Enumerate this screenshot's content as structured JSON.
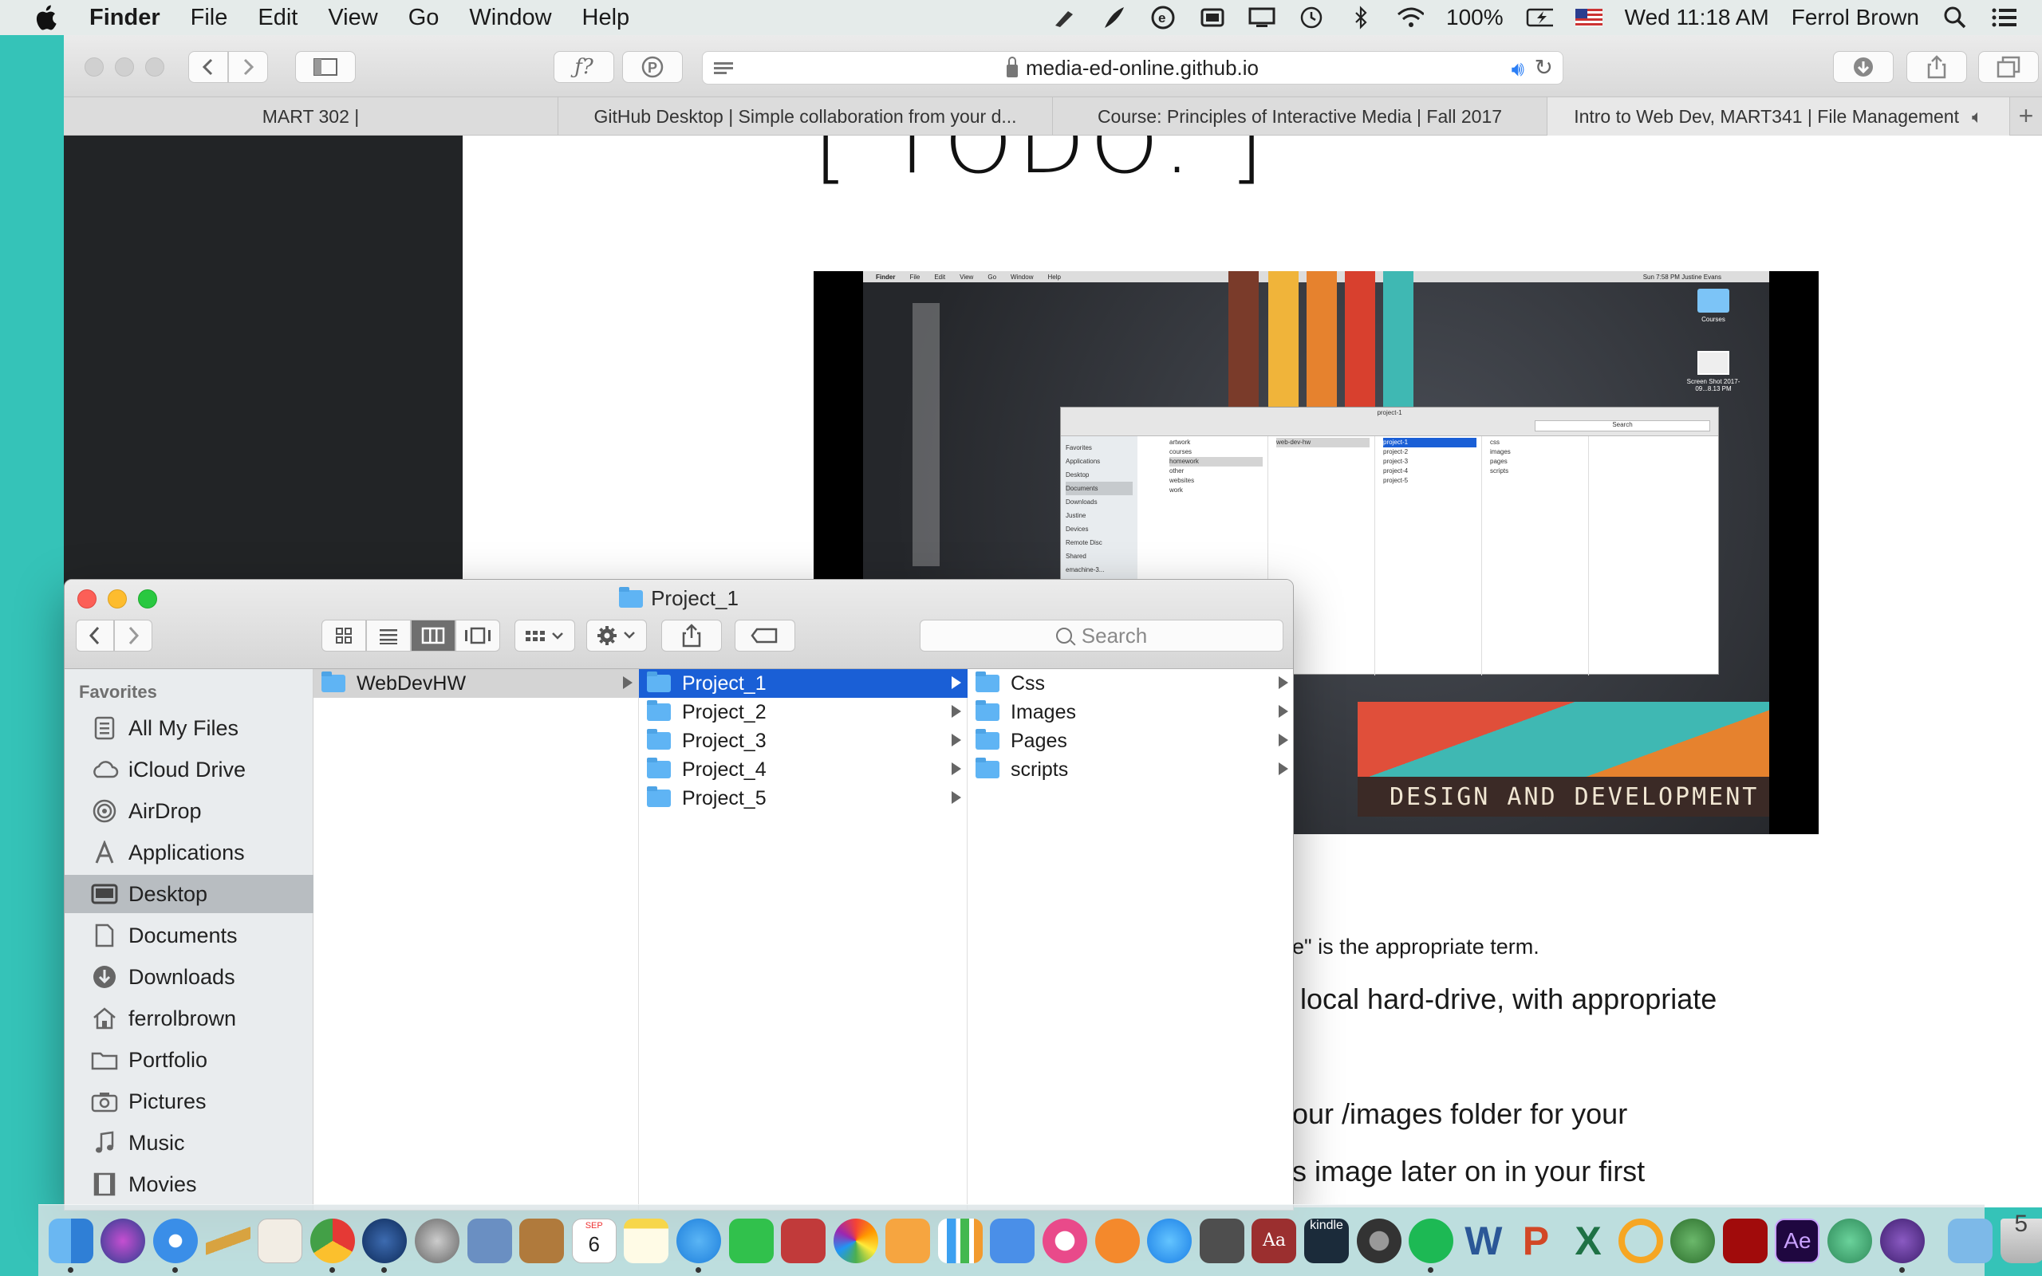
{
  "menubar": {
    "app_name": "Finder",
    "menus": [
      "File",
      "Edit",
      "View",
      "Go",
      "Window",
      "Help"
    ],
    "battery": "100%",
    "clock": "Wed 11:18 AM",
    "user": "Ferrol Brown"
  },
  "browser": {
    "url": "media-ed-online.github.io",
    "tabs": [
      {
        "label": "MART 302 |"
      },
      {
        "label": "GitHub Desktop | Simple collaboration from your d..."
      },
      {
        "label": "Course: Principles of Interactive Media | Fall 2017"
      },
      {
        "label": "Intro to Web Dev, MART341 | File Management"
      }
    ],
    "page": {
      "heading": "[ TODO: ]",
      "lines": [
        "e\" is the appropriate term.",
        "local hard-drive, with appropriate",
        "our /images folder for your",
        "s image later on in your first"
      ],
      "embedded": {
        "banner": "DESIGN AND DEVELOPMENT",
        "mini_menus": [
          "Finder",
          "File",
          "Edit",
          "View",
          "Go",
          "Window",
          "Help"
        ],
        "mini_status": "Sun 7:58 PM   Justine Evans",
        "mini_title": "project-1",
        "mini_search": "Search",
        "mini_sidebar": [
          "Favorites",
          "Applications",
          "Desktop",
          "Documents",
          "Downloads",
          "Justine",
          "Devices",
          "Remote Disc",
          "Shared",
          "emachine-3..."
        ],
        "mini_col1": [
          "artwork",
          "courses",
          "homework",
          "other",
          "websites",
          "work"
        ],
        "mini_col2": [
          "web-dev-hw"
        ],
        "mini_col3": [
          "project-1",
          "project-2",
          "project-3",
          "project-4",
          "project-5"
        ],
        "mini_col4": [
          "css",
          "images",
          "pages",
          "scripts"
        ],
        "desk_icon1": "Courses",
        "desk_icon2": "Screen Shot 2017-09...8.13 PM"
      }
    }
  },
  "finder": {
    "title": "Project_1",
    "search_placeholder": "Search",
    "sidebar_heading": "Favorites",
    "sidebar": [
      {
        "label": "All My Files",
        "icon": "all-files-icon"
      },
      {
        "label": "iCloud Drive",
        "icon": "cloud-icon"
      },
      {
        "label": "AirDrop",
        "icon": "airdrop-icon"
      },
      {
        "label": "Applications",
        "icon": "applications-icon"
      },
      {
        "label": "Desktop",
        "icon": "desktop-icon",
        "selected": true
      },
      {
        "label": "Documents",
        "icon": "documents-icon"
      },
      {
        "label": "Downloads",
        "icon": "downloads-icon"
      },
      {
        "label": "ferrolbrown",
        "icon": "home-icon"
      },
      {
        "label": "Portfolio",
        "icon": "folder-icon"
      },
      {
        "label": "Pictures",
        "icon": "camera-icon"
      },
      {
        "label": "Music",
        "icon": "music-note-icon"
      },
      {
        "label": "Movies",
        "icon": "film-icon"
      }
    ],
    "columns": [
      [
        "WebDevHW"
      ],
      [
        "Project_1",
        "Project_2",
        "Project_3",
        "Project_4",
        "Project_5"
      ],
      [
        "Css",
        "Images",
        "Pages",
        "scripts"
      ]
    ]
  },
  "dock": {
    "trailing_number": "5",
    "calendar_month": "SEP",
    "calendar_day": "6",
    "kindle_label": "kindle",
    "ae_label": "Ae",
    "dictionary_label": "Aa"
  }
}
